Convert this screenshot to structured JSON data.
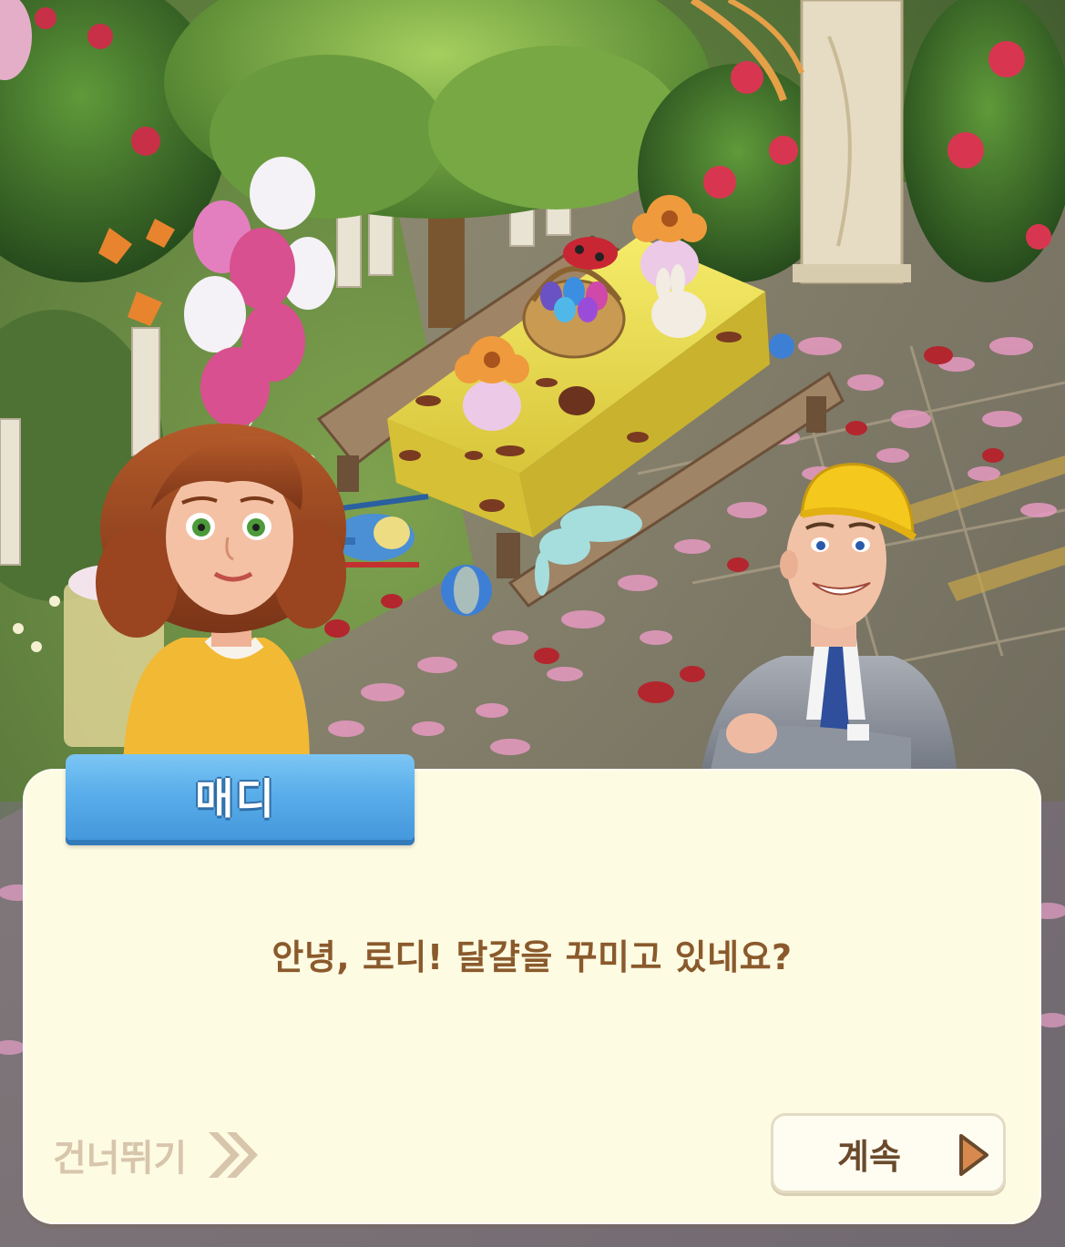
{
  "dialog": {
    "speaker_name": "매디",
    "text": "안녕, 로디! 달걀을 꾸미고 있네요?"
  },
  "controls": {
    "skip_label": "건너뛰기",
    "skip_icon": "double-chevron-right-icon",
    "continue_label": "계속",
    "continue_icon": "play-arrow-icon"
  },
  "colors": {
    "dialog_background": "#fefbe3",
    "speaker_tab": "#5aaeea",
    "dialog_text": "#8a5a2c",
    "skip_text": "#d7c6ac",
    "continue_arrow": "#d88a4e"
  }
}
